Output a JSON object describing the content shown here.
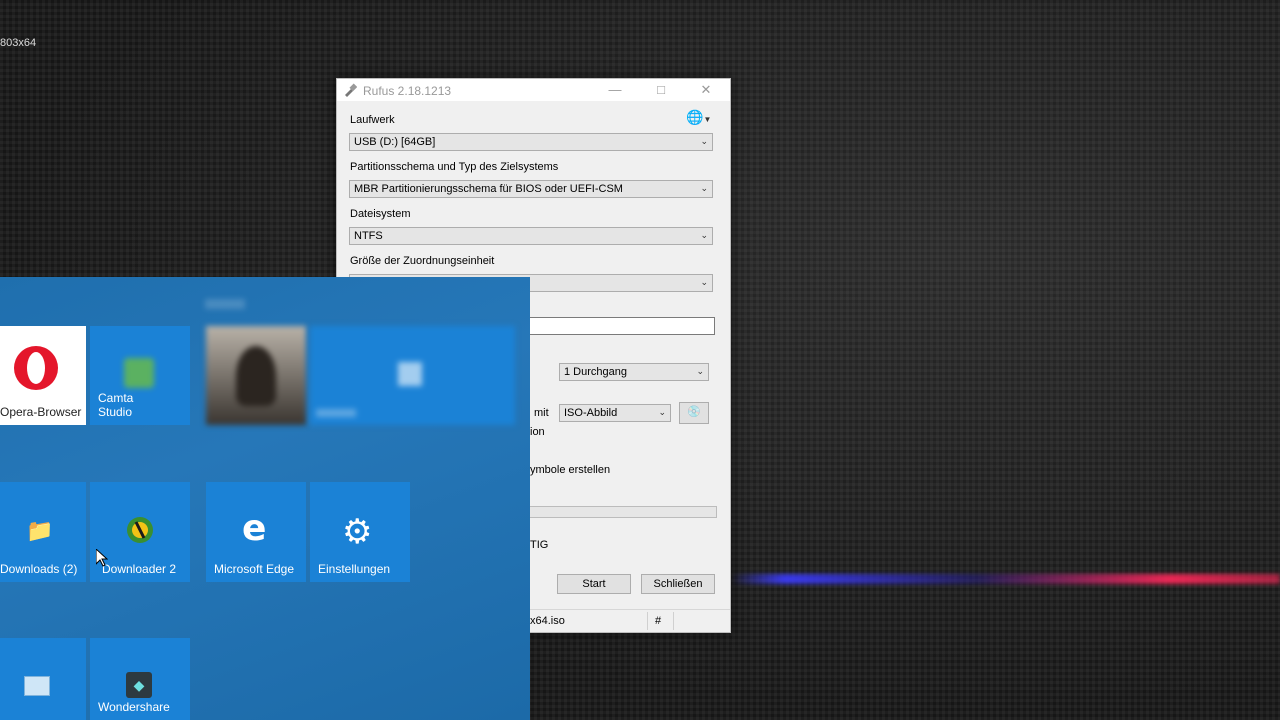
{
  "desktop": {
    "resolution_label": "803x64"
  },
  "rufus": {
    "title": "Rufus 2.18.1213",
    "laufwerk_label": "Laufwerk",
    "laufwerk_value": "USB (D:) [64GB]",
    "partition_label": "Partitionsschema und Typ des Zielsystems",
    "partition_value": "MBR Partitionierungsschema für BIOS oder UEFI-CSM",
    "dateisystem_label": "Dateisystem",
    "dateisystem_value": "NTFS",
    "cluster_label": "Größe der Zuordnungseinheit",
    "passes_value": "1 Durchgang",
    "boot_with_label": "mit",
    "boot_type_value": "ISO-Abbild",
    "partial_option_text": "ion",
    "partial_icons_text": "ymbole erstellen",
    "status_text": "TIG",
    "start_button": "Start",
    "close_button": "Schließen",
    "status_iso": "x64.iso",
    "status_hash": "#"
  },
  "startmenu": {
    "tiles": {
      "opera": "Opera-Browser",
      "camtasia_line1": "Camta",
      "camtasia_line2": "Studio",
      "downloads": "Downloads (2)",
      "jdownloader": "Downloader 2",
      "edge": "Microsoft Edge",
      "settings": "Einstellungen",
      "wondershare": "Wondershare"
    }
  },
  "colors": {
    "tile_blue": "#1b82d6",
    "opera_red": "#e4162b",
    "menu_bg": "#2677b8"
  }
}
